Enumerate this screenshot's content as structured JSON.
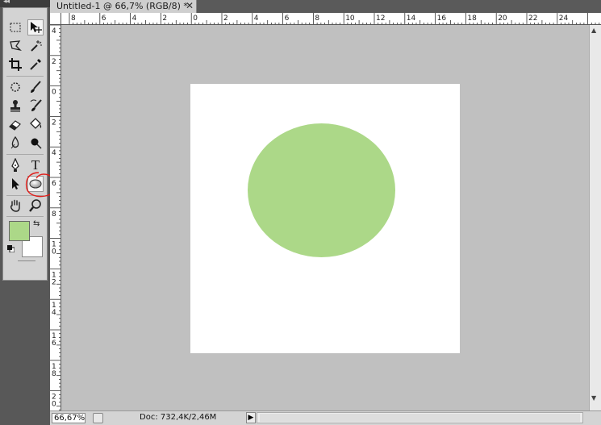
{
  "window": {
    "tab_title": "Untitled-1 @ 66,7% (RGB/8) *",
    "close_glyph": "✕"
  },
  "toolbox": {
    "header_glyph": "◂◂",
    "tools": [
      {
        "name": "rectangular-marquee-tool",
        "icon": "marquee-icon"
      },
      {
        "name": "move-tool",
        "icon": "move-icon"
      },
      {
        "name": "polygonal-lasso-tool",
        "icon": "lasso-icon"
      },
      {
        "name": "magic-wand-tool",
        "icon": "magic-wand-icon"
      },
      {
        "name": "crop-tool",
        "icon": "crop-icon"
      },
      {
        "name": "eyedropper-tool",
        "icon": "eyedropper-icon"
      },
      {
        "name": "spot-healing-tool",
        "icon": "healing-icon"
      },
      {
        "name": "brush-tool",
        "icon": "brush-icon"
      },
      {
        "name": "clone-stamp-tool",
        "icon": "stamp-icon"
      },
      {
        "name": "history-brush-tool",
        "icon": "history-brush-icon"
      },
      {
        "name": "eraser-tool",
        "icon": "eraser-icon"
      },
      {
        "name": "paint-bucket-tool",
        "icon": "bucket-icon"
      },
      {
        "name": "blur-tool",
        "icon": "blur-icon"
      },
      {
        "name": "burn-tool",
        "icon": "burn-icon"
      },
      {
        "name": "pen-tool",
        "icon": "pen-icon"
      },
      {
        "name": "type-tool",
        "icon": "type-icon",
        "label": "T"
      },
      {
        "name": "path-selection-tool",
        "icon": "arrow-icon"
      },
      {
        "name": "ellipse-tool",
        "icon": "ellipse-icon",
        "active": true
      },
      {
        "name": "hand-tool",
        "icon": "hand-icon"
      },
      {
        "name": "zoom-tool",
        "icon": "zoom-icon"
      }
    ],
    "foreground_color": "#acd888",
    "background_color": "#ffffff",
    "swap_glyph": "⇆"
  },
  "rulers": {
    "horizontal_labels": [
      "8",
      "6",
      "4",
      "2",
      "0",
      "2",
      "4",
      "6",
      "8",
      "10",
      "12",
      "14",
      "16",
      "18",
      "20",
      "22",
      "24"
    ],
    "vertical_labels": [
      "4",
      "2",
      "0",
      "2",
      "4",
      "6",
      "8",
      "10",
      "12",
      "14",
      "16",
      "18",
      "20"
    ]
  },
  "document": {
    "background": "#ffffff",
    "ellipse_color": "#acd888",
    "pasteboard": "#c0c0c0"
  },
  "status_bar": {
    "zoom": "66,67%",
    "doc_info": "Doc: 732,4K/2,46M",
    "arrow_glyph": "▶"
  },
  "annotation": {
    "color": "#e0201c"
  }
}
